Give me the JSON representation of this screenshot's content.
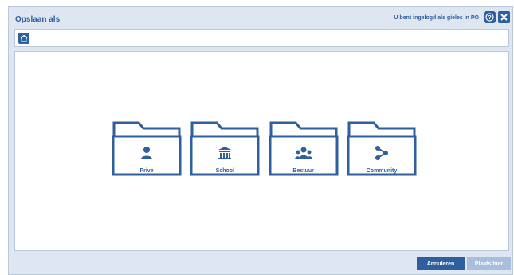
{
  "dialog": {
    "title": "Opslaan als",
    "login_text": "U bent ingelogd als gieles in PO"
  },
  "toolbar": {
    "help_icon": "help-icon",
    "close_icon": "close-icon",
    "home_icon": "home-icon"
  },
  "folders": [
    {
      "label": "Prive",
      "icon": "person-icon"
    },
    {
      "label": "School",
      "icon": "school-icon"
    },
    {
      "label": "Bestuur",
      "icon": "group-icon"
    },
    {
      "label": "Community",
      "icon": "share-icon"
    }
  ],
  "buttons": {
    "cancel_label": "Annuleren",
    "place_label": "Plaats hier"
  },
  "colors": {
    "accent": "#2f5f9c",
    "background": "#dde6f1",
    "disabled": "#a9bedc"
  }
}
